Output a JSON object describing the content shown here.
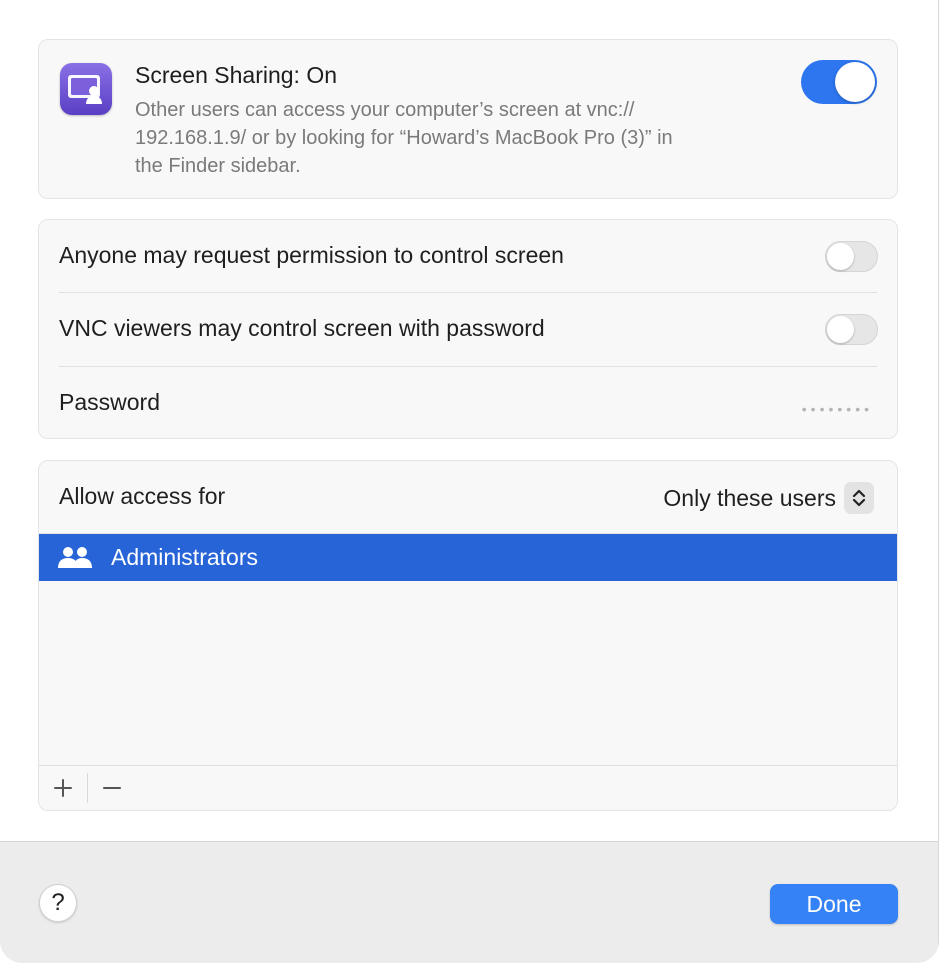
{
  "screen_sharing": {
    "title": "Screen Sharing: On",
    "description_lines": [
      "Other users can access your computer’s screen at vnc://",
      "192.168.1.9/ or by looking for “Howard’s MacBook Pro (3)” in",
      "the Finder sidebar."
    ],
    "enabled": true,
    "icon": "screen-sharing-app-icon"
  },
  "options": {
    "request_permission_label": "Anyone may request permission to control screen",
    "request_permission_enabled": false,
    "vnc_password_label": "VNC viewers may control screen with password",
    "vnc_password_enabled": false,
    "password_label": "Password",
    "password_value": "••••••••"
  },
  "access": {
    "label": "Allow access for",
    "selected_option": "Only these users",
    "users": [
      {
        "name": "Administrators",
        "icon": "group-icon",
        "selected": true
      }
    ],
    "add_symbol": "+",
    "remove_symbol": "−"
  },
  "footer": {
    "help_label": "?",
    "done_label": "Done"
  },
  "colors": {
    "accent": "#2d76f0",
    "selection": "#2764d8",
    "done_button": "#3482f6"
  }
}
